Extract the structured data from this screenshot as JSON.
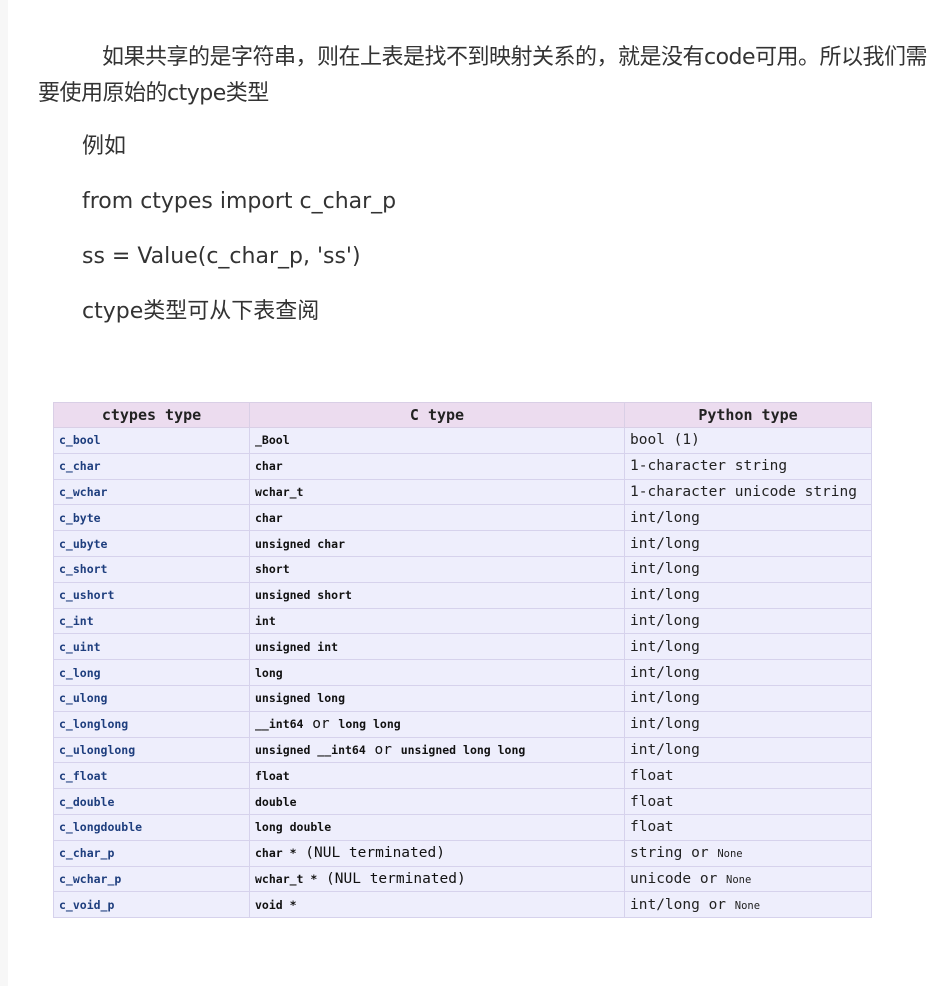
{
  "article": {
    "intro": "如果共享的是字符串，则在上表是找不到映射关系的，就是没有code可用。所以我们需要使用原始的ctype类型",
    "example_label": "例如",
    "code_line_1": "from ctypes import c_char_p",
    "code_line_2": "ss = Value(c_char_p, 'ss')",
    "lookup_note": "ctype类型可从下表查阅"
  },
  "table": {
    "headers": [
      "ctypes type",
      "C type",
      "Python type"
    ],
    "rows": [
      {
        "ctype": "c_bool",
        "c": "_Bool",
        "c_note": "",
        "py": "bool (1)",
        "py_note": ""
      },
      {
        "ctype": "c_char",
        "c": "char",
        "c_note": "",
        "py": "1-character string",
        "py_note": ""
      },
      {
        "ctype": "c_wchar",
        "c": "wchar_t",
        "c_note": "",
        "py": "1-character unicode string",
        "py_note": ""
      },
      {
        "ctype": "c_byte",
        "c": "char",
        "c_note": "",
        "py": "int/long",
        "py_note": ""
      },
      {
        "ctype": "c_ubyte",
        "c": "unsigned char",
        "c_note": "",
        "py": "int/long",
        "py_note": ""
      },
      {
        "ctype": "c_short",
        "c": "short",
        "c_note": "",
        "py": "int/long",
        "py_note": ""
      },
      {
        "ctype": "c_ushort",
        "c": "unsigned short",
        "c_note": "",
        "py": "int/long",
        "py_note": ""
      },
      {
        "ctype": "c_int",
        "c": "int",
        "c_note": "",
        "py": "int/long",
        "py_note": ""
      },
      {
        "ctype": "c_uint",
        "c": "unsigned int",
        "c_note": "",
        "py": "int/long",
        "py_note": ""
      },
      {
        "ctype": "c_long",
        "c": "long",
        "c_note": "",
        "py": "int/long",
        "py_note": ""
      },
      {
        "ctype": "c_ulong",
        "c": "unsigned long",
        "c_note": "",
        "py": "int/long",
        "py_note": ""
      },
      {
        "ctype": "c_longlong",
        "c": "__int64",
        "c_mid": " or ",
        "c2": "long long",
        "c_note": "",
        "py": "int/long",
        "py_note": ""
      },
      {
        "ctype": "c_ulonglong",
        "c": "unsigned __int64",
        "c_mid": " or ",
        "c2": "unsigned long long",
        "c_note": "",
        "py": "int/long",
        "py_note": ""
      },
      {
        "ctype": "c_float",
        "c": "float",
        "c_note": "",
        "py": "float",
        "py_note": ""
      },
      {
        "ctype": "c_double",
        "c": "double",
        "c_note": "",
        "py": "float",
        "py_note": ""
      },
      {
        "ctype": "c_longdouble",
        "c": "long double",
        "c_note": "",
        "py": "float",
        "py_note": ""
      },
      {
        "ctype": "c_char_p",
        "c": "char *",
        "c_note": " (NUL terminated)",
        "py": "string or ",
        "py_note": "None"
      },
      {
        "ctype": "c_wchar_p",
        "c": "wchar_t *",
        "c_note": " (NUL terminated)",
        "py": "unicode or ",
        "py_note": "None"
      },
      {
        "ctype": "c_void_p",
        "c": "void *",
        "c_note": "",
        "py": "int/long or ",
        "py_note": "None"
      }
    ]
  }
}
